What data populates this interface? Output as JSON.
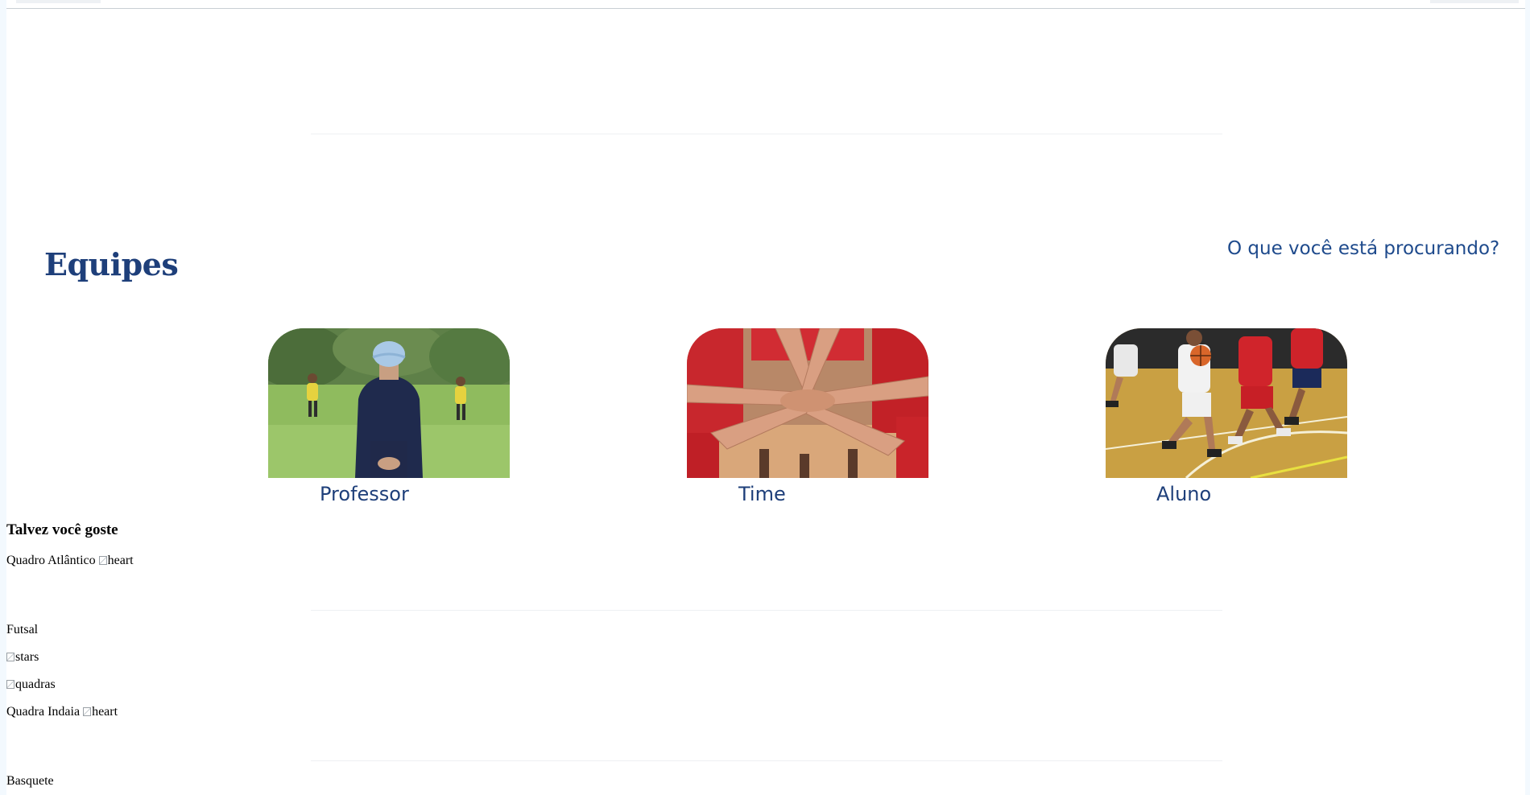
{
  "header": {
    "title": "Equipes",
    "search_link": "O que você está procurando?"
  },
  "cards": [
    {
      "label": "Professor",
      "image": "coach-watching-soccer-photo"
    },
    {
      "label": "Time",
      "image": "team-hands-huddle-photo"
    },
    {
      "label": "Aluno",
      "image": "basketball-players-photo"
    }
  ],
  "recommendations": {
    "heading": "Talvez você goste",
    "items": [
      {
        "name": "Quadro Atlântico",
        "heart_alt": "heart"
      },
      {
        "name": "Futsal"
      },
      {
        "stars_alt": "stars"
      },
      {
        "quadras_alt": "quadras"
      },
      {
        "name": "Quadra Indaia",
        "heart_alt": "heart"
      },
      {
        "name": "Basquete"
      }
    ]
  },
  "colors": {
    "brand_blue": "#1e3f7a",
    "link_blue": "#1e4a8c",
    "side_strip": "#f3f9fe"
  }
}
